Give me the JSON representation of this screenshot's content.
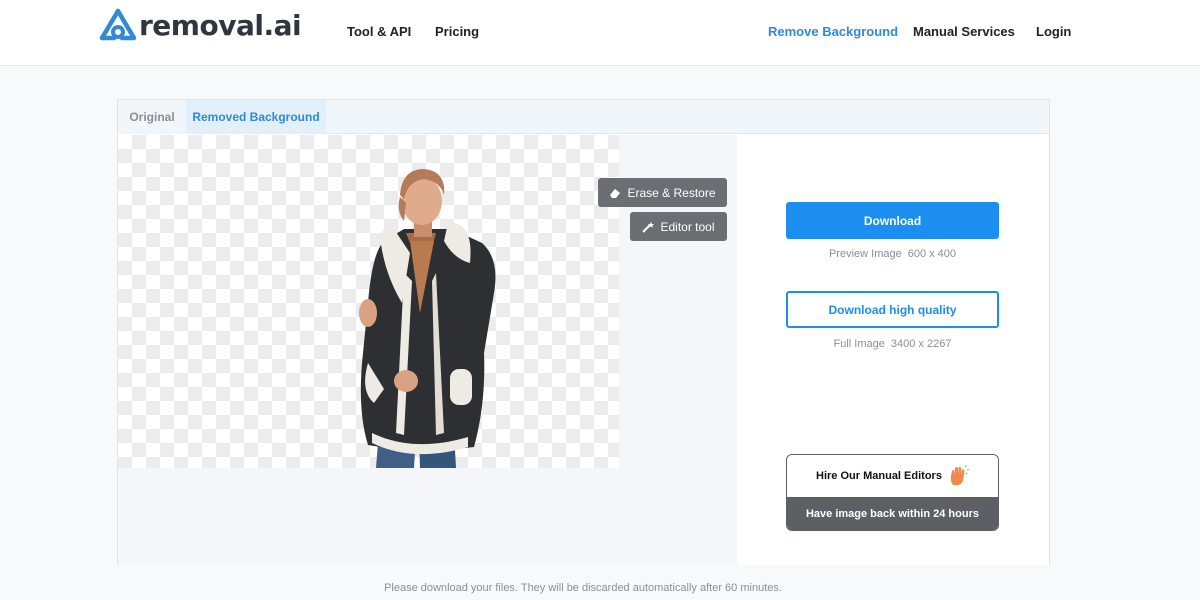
{
  "header": {
    "logo_text": "removal.ai",
    "nav": {
      "tool_api": "Tool & API",
      "pricing": "Pricing",
      "remove_background": "Remove Background",
      "manual_services": "Manual Services",
      "login": "Login"
    }
  },
  "tabs": {
    "original": "Original",
    "removed_background": "Removed Background"
  },
  "tools": {
    "erase_restore": "Erase & Restore",
    "editor_tool": "Editor tool"
  },
  "download": {
    "label": "Download",
    "preview_label": "Preview Image",
    "preview_size": "600 x 400"
  },
  "download_hq": {
    "label": "Download high quality",
    "full_label": "Full Image",
    "full_size": "3400 x 2267"
  },
  "hire": {
    "title": "Hire Our Manual Editors",
    "subtitle": "Have image back within 24 hours"
  },
  "footer_note": "Please download your files. They will be discarded automatically after 60 minutes.",
  "colors": {
    "accent": "#1c8ef0",
    "nav_active": "#2f8ad7",
    "tool_button": "#6b6e73",
    "hire_bar": "#5c5f63"
  }
}
